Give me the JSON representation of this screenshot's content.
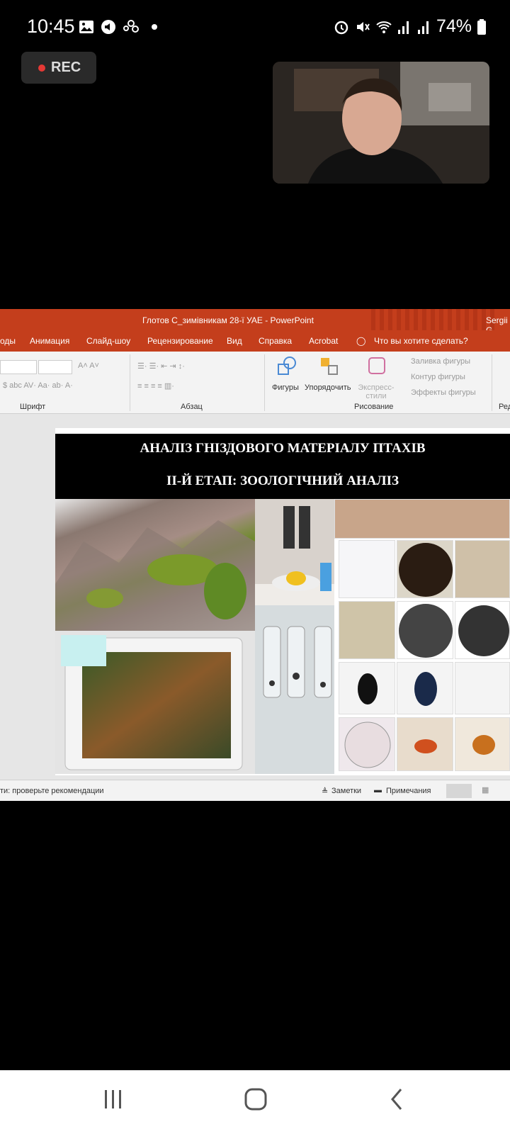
{
  "status_bar": {
    "time": "10:45",
    "battery": "74%",
    "icons": [
      "gallery-icon",
      "media-icon",
      "people-icon",
      "dot-icon",
      "alarm-icon",
      "mute-icon",
      "wifi-icon",
      "signal-icon",
      "signal-icon",
      "battery-icon"
    ]
  },
  "rec": {
    "label": "REC",
    "color": "#e53935"
  },
  "powerpoint": {
    "window_title": "Глотов С_зимівникам 28-ї УАЕ  -  PowerPoint",
    "user": "Sergii G",
    "tabs": [
      "оды",
      "Анимация",
      "Слайд-шоу",
      "Рецензирование",
      "Вид",
      "Справка",
      "Acrobat"
    ],
    "tell_me": "Что вы хотите сделать?",
    "ribbon": {
      "group_font": "Шрифт",
      "group_paragraph": "Абзац",
      "group_drawing": "Рисование",
      "group_edit": "Ред",
      "shapes_label": "Фигуры",
      "arrange_label": "Упорядочить",
      "styles_label": "Экспресс-стили",
      "fill": "Заливка фигуры",
      "outline": "Контур фигуры",
      "effects": "Эффекты фигуры"
    },
    "slide": {
      "title_line1": "АНАЛІЗ ГНІЗДОВОГО МАТЕРІАЛУ ПТАХІВ",
      "title_line2": "ІІ-Й ЕТАП: ЗООЛОГІЧНИЙ АНАЛІЗ"
    },
    "statusbar": {
      "hint": "ти: проверьте рекомендации",
      "notes": "Заметки",
      "comments": "Примечания"
    }
  },
  "colors": {
    "accent": "#c43e1c",
    "background": "#000000"
  }
}
